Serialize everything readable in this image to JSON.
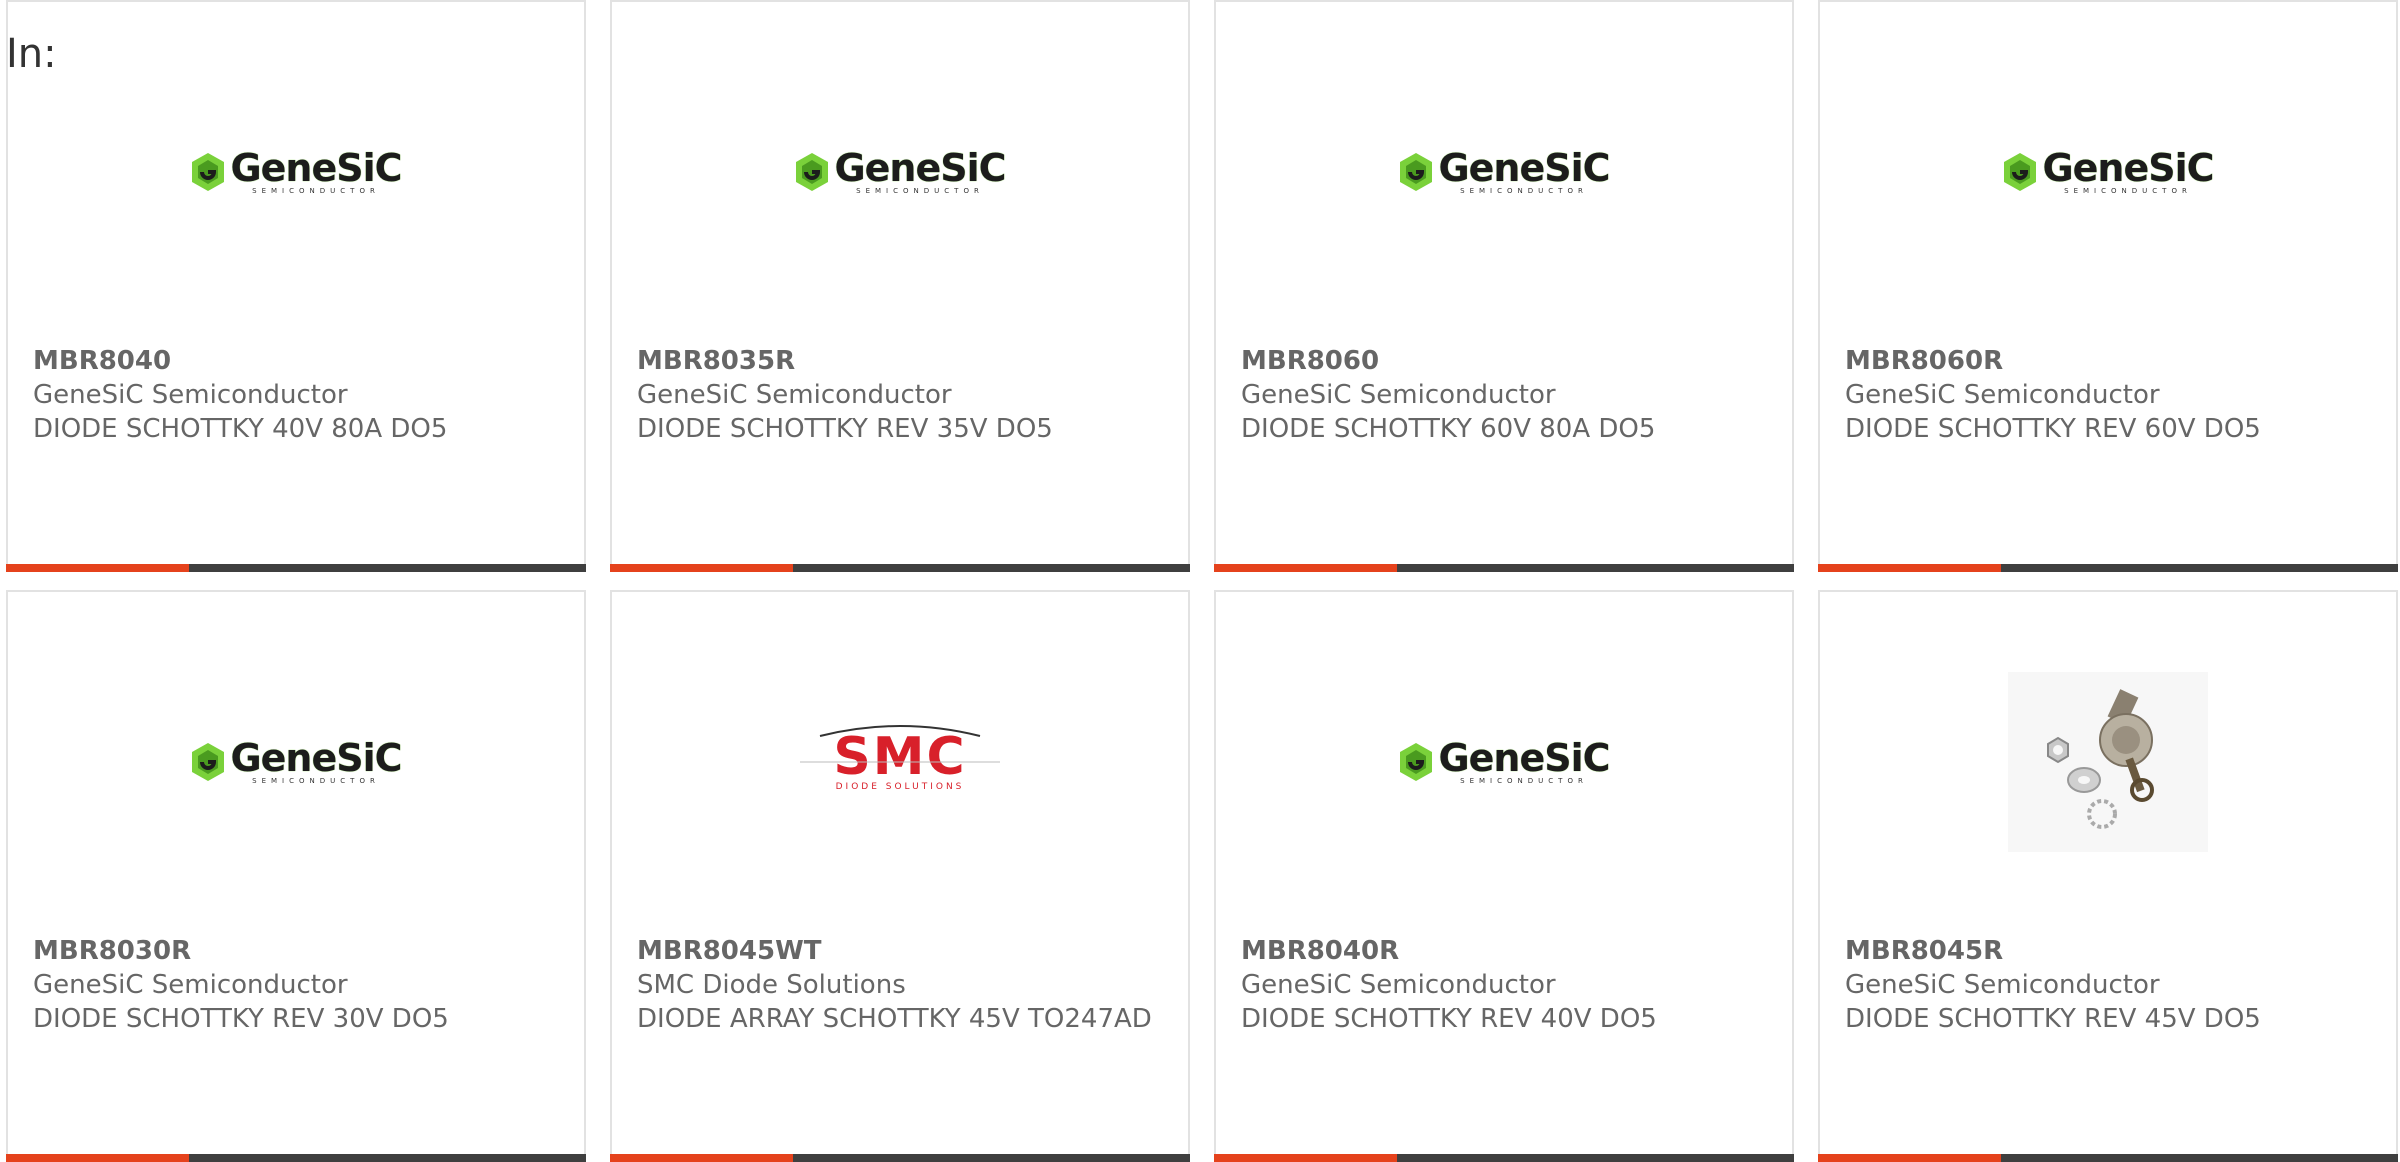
{
  "header": {
    "label": "In:"
  },
  "colors": {
    "accent": "#e5421c",
    "bar": "#3f3f3f",
    "genesic_green": "#7ad13a",
    "smc_red": "#d8202a"
  },
  "products": [
    {
      "part": "MBR8040",
      "manufacturer": "GeneSiC Semiconductor",
      "description": "DIODE SCHOTTKY 40V 80A DO5",
      "image": "genesic-logo",
      "logo_text": "GeneSiC",
      "logo_sub": "SEMICONDUCTOR"
    },
    {
      "part": "MBR8035R",
      "manufacturer": "GeneSiC Semiconductor",
      "description": "DIODE SCHOTTKY REV 35V DO5",
      "image": "genesic-logo",
      "logo_text": "GeneSiC",
      "logo_sub": "SEMICONDUCTOR"
    },
    {
      "part": "MBR8060",
      "manufacturer": "GeneSiC Semiconductor",
      "description": "DIODE SCHOTTKY 60V 80A DO5",
      "image": "genesic-logo",
      "logo_text": "GeneSiC",
      "logo_sub": "SEMICONDUCTOR"
    },
    {
      "part": "MBR8060R",
      "manufacturer": "GeneSiC Semiconductor",
      "description": "DIODE SCHOTTKY REV 60V DO5",
      "image": "genesic-logo",
      "logo_text": "GeneSiC",
      "logo_sub": "SEMICONDUCTOR"
    },
    {
      "part": "MBR8030R",
      "manufacturer": "GeneSiC Semiconductor",
      "description": "DIODE SCHOTTKY REV 30V DO5",
      "image": "genesic-logo",
      "logo_text": "GeneSiC",
      "logo_sub": "SEMICONDUCTOR"
    },
    {
      "part": "MBR8045WT",
      "manufacturer": "SMC Diode Solutions",
      "description": "DIODE ARRAY SCHOTTKY 45V TO247AD",
      "image": "smc-logo",
      "logo_text": "SMC",
      "logo_sub": "DIODE SOLUTIONS"
    },
    {
      "part": "MBR8040R",
      "manufacturer": "GeneSiC Semiconductor",
      "description": "DIODE SCHOTTKY REV 40V DO5",
      "image": "genesic-logo",
      "logo_text": "GeneSiC",
      "logo_sub": "SEMICONDUCTOR"
    },
    {
      "part": "MBR8045R",
      "manufacturer": "GeneSiC Semiconductor",
      "description": "DIODE SCHOTTKY REV 45V DO5",
      "image": "stud-diode-photo",
      "logo_text": "",
      "logo_sub": ""
    }
  ]
}
